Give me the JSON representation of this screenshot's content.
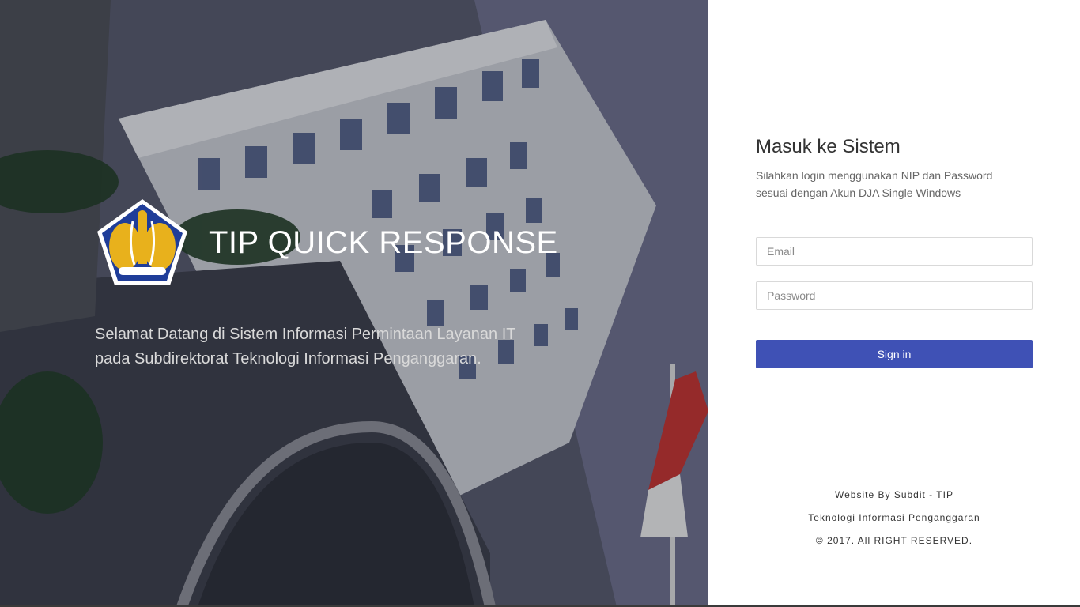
{
  "hero": {
    "title": "TIP QUICK RESPONSE",
    "welcome_line1": "Selamat Datang di Sistem Informasi Permintaan Layanan IT",
    "welcome_line2": "pada Subdirektorat Teknologi Informasi Penganggaran.",
    "logo_icon": "kemenkeu-emblem-icon",
    "background_icon": "building-photo"
  },
  "login": {
    "title": "Masuk ke Sistem",
    "desc_line1": "Silahkan login menggunakan NIP dan Password",
    "desc_line2": "sesuai dengan Akun DJA Single Windows",
    "email_placeholder": "Email",
    "email_value": "",
    "password_placeholder": "Password",
    "password_value": "",
    "signin_label": "Sign in"
  },
  "footer": {
    "line1": "Website By Subdit - TIP",
    "line2": "Teknologi Informasi Penganggaran",
    "line3": "© 2017. All RIGHT RESERVED."
  },
  "colors": {
    "accent": "#3f51b5",
    "emblem_blue": "#1f3d99",
    "emblem_gold": "#e8b11c"
  }
}
